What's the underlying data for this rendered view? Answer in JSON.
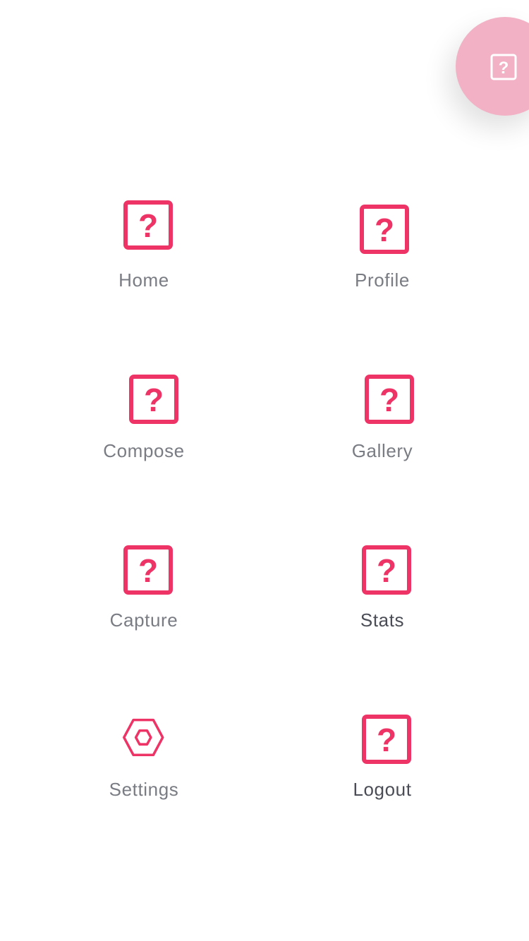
{
  "colors": {
    "accent": "#ee3466",
    "fab_background": "#f2b1c5",
    "label_text": "#7a7c84",
    "label_text_active": "#4b4d56",
    "background": "#ffffff"
  },
  "fab": {
    "icon": "question-box-icon"
  },
  "menu": {
    "items": [
      {
        "label": "Home",
        "icon": "question-box-icon"
      },
      {
        "label": "Profile",
        "icon": "question-box-icon"
      },
      {
        "label": "Compose",
        "icon": "question-box-icon"
      },
      {
        "label": "Gallery",
        "icon": "question-box-icon"
      },
      {
        "label": "Capture",
        "icon": "question-box-icon"
      },
      {
        "label": "Stats",
        "icon": "question-box-icon"
      },
      {
        "label": "Settings",
        "icon": "hexagon-icon"
      },
      {
        "label": "Logout",
        "icon": "question-box-icon"
      }
    ]
  }
}
